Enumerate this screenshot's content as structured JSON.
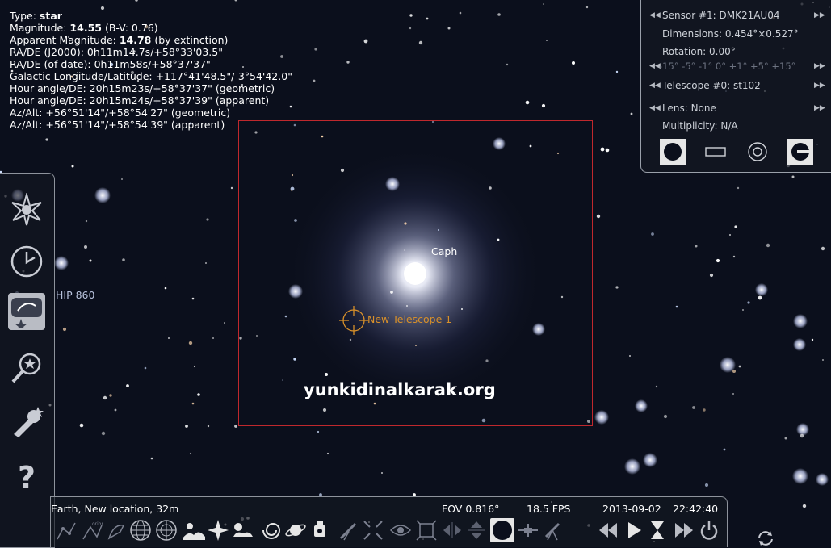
{
  "object_info": {
    "type_label": "Type: ",
    "type_value": "star",
    "magnitude_label": "Magnitude: ",
    "magnitude_value": "14.55",
    "magnitude_suffix": " (B-V: 0.76)",
    "apparent_mag_label": "Apparent Magnitude: ",
    "apparent_mag_value": "14.78",
    "apparent_mag_suffix": " (by extinction)",
    "ra_dec_j2000": "RA/DE (J2000): 0h11m14.7s/+58°33'03.5\"",
    "ra_dec_date": "RA/DE (of date): 0h11m58s/+58°37'37\"",
    "galactic": "Galactic Longitude/Latitude: +117°41'48.5\"/-3°54'42.0\"",
    "hour_angle_geo": "Hour angle/DE: 20h15m23s/+58°37'37\" (geometric)",
    "hour_angle_app": "Hour angle/DE: 20h15m24s/+58°37'39\" (apparent)",
    "azalt_geo": "Az/Alt: +56°51'14\"/+58°54'27\" (geometric)",
    "azalt_app": "Az/Alt: +56°51'14\"/+58°54'39\" (apparent)"
  },
  "oculars_panel": {
    "sensor": "Sensor #1: DMK21AU04",
    "dimensions": "Dimensions: 0.454°×0.527°",
    "rotation": "Rotation: 0.00°",
    "rotation_scale": "-15° -5° -1° 0° +1° +5° +15°",
    "telescope": "Telescope #0: st102",
    "lens": "Lens: None",
    "multiplicity": "Multiplicity: N/A"
  },
  "sky_labels": {
    "caph": "Caph",
    "hip": "HIP 860",
    "telescope": "New Telescope 1",
    "watermark": "yunkidinalkarak.org"
  },
  "status_bar": {
    "location": "Earth, New location, 32m",
    "fov": "FOV 0.816°",
    "fps": "18.5 FPS",
    "date": "2013-09-02",
    "time": "22:42:40"
  },
  "left_toolbar": [
    "location-window-icon",
    "date-time-window-icon",
    "sky-view-options-icon",
    "search-window-icon",
    "configuration-window-icon",
    "help-window-icon"
  ],
  "colors": {
    "fov_frame": "#c0282d",
    "telescope_reticle": "#d8902a",
    "panel_border": "#9aa0aa",
    "sky": "#0b0f1c"
  }
}
